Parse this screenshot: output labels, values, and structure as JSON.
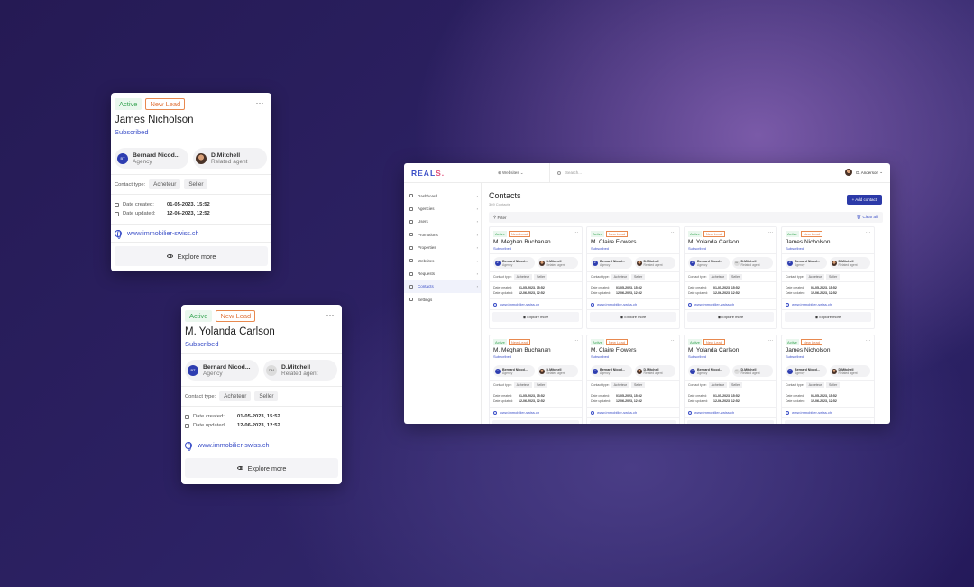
{
  "card_a": {
    "status": "Active",
    "lead": "New Lead",
    "name": "James Nicholson",
    "subscription": "Subscribed",
    "agency_initials": "BT",
    "agency_name": "Bernard Nicod...",
    "agency_role": "Agency",
    "agent_initials": "",
    "agent_name": "D.Mitchell",
    "agent_role": "Related agent",
    "contact_type_label": "Contact type:",
    "tags": [
      "Acheteur",
      "Seller"
    ],
    "created_label": "Date created:",
    "created": "01-05-2023, 15:52",
    "updated_label": "Date updated:",
    "updated": "12-06-2023, 12:52",
    "website": "www.immobilier-swiss.ch",
    "explore": "Explore more",
    "more": "···"
  },
  "card_b": {
    "status": "Active",
    "lead": "New Lead",
    "name": "M. Yolanda Carlson",
    "subscription": "Subscribed",
    "agency_initials": "BT",
    "agency_name": "Bernard Nicod...",
    "agency_role": "Agency",
    "agent_initials": "DM",
    "agent_name": "D.Mitchell",
    "agent_role": "Related agent",
    "contact_type_label": "Contact type:",
    "tags": [
      "Acheteur",
      "Seller"
    ],
    "created_label": "Date created:",
    "created": "01-05-2023, 15:52",
    "updated_label": "Date updated:",
    "updated": "12-06-2023, 12:52",
    "website": "www.immobilier-swiss.ch",
    "explore": "Explore more",
    "more": "···"
  },
  "app": {
    "logo_main": "REAL",
    "logo_accent": "S.",
    "website_select": "Websites",
    "search_placeholder": "Search...",
    "user_name": "D. Anderson",
    "sidebar": [
      "Dashboard",
      "Agencies",
      "Users",
      "Promotions",
      "Properties",
      "Websites",
      "Requests",
      "Contacts",
      "Settings"
    ],
    "sidebar_active": "Contacts",
    "page_title": "Contacts",
    "page_count": "369 Contacts",
    "add_button": "+ Add contact",
    "filter_label": "Filter",
    "clear_all": "Clear all",
    "contacts": [
      {
        "name": "M. Meghan Buchanan",
        "agent_avatar": "photo"
      },
      {
        "name": "M. Claire Flowers",
        "agent_avatar": "photo"
      },
      {
        "name": "M. Yolanda Carlson",
        "agent_avatar": "initials"
      },
      {
        "name": "James Nicholson",
        "agent_avatar": "photo"
      },
      {
        "name": "M. Meghan Buchanan",
        "agent_avatar": "photo"
      },
      {
        "name": "M. Claire Flowers",
        "agent_avatar": "photo"
      },
      {
        "name": "M. Yolanda Carlson",
        "agent_avatar": "initials"
      },
      {
        "name": "James Nicholson",
        "agent_avatar": "photo"
      }
    ],
    "card_template": {
      "status": "Active",
      "lead": "New Lead",
      "subscription": "Subscribed",
      "agency_initials": "BT",
      "agency_name": "Bernard Nicod...",
      "agency_role": "Agency",
      "agent_initials": "DM",
      "agent_name": "D.Mitchell",
      "agent_role": "Related agent",
      "contact_type_label": "Contact type:",
      "tags": [
        "Acheteur",
        "Seller"
      ],
      "created_label": "Date created:",
      "created": "01-05-2023, 15:52",
      "updated_label": "Date updated:",
      "updated": "12-06-2023, 12:52",
      "website": "www.immobilier-swiss.ch",
      "explore": "Explore more",
      "more": "···"
    }
  }
}
